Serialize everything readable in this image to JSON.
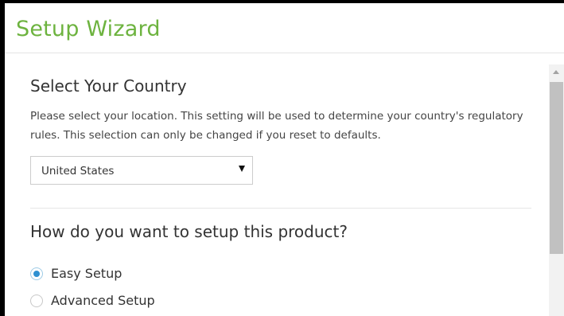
{
  "header": {
    "title": "Setup Wizard",
    "title_color": "#6db33f"
  },
  "country_section": {
    "title": "Select Your Country",
    "description": "Please select your location. This setting will be used to determine your country's regulatory rules. This selection can only be changed if you reset to defaults.",
    "select": {
      "selected_value": "United States",
      "arrow_icon": "triangle-down-icon"
    }
  },
  "setup_section": {
    "question": "How do you want to setup this product?",
    "options": [
      {
        "label": "Easy Setup",
        "selected": true
      },
      {
        "label": "Advanced Setup",
        "selected": false
      }
    ],
    "accent_color": "#2e90d1"
  },
  "scrollbar": {
    "up_icon": "arrow-up-icon"
  }
}
